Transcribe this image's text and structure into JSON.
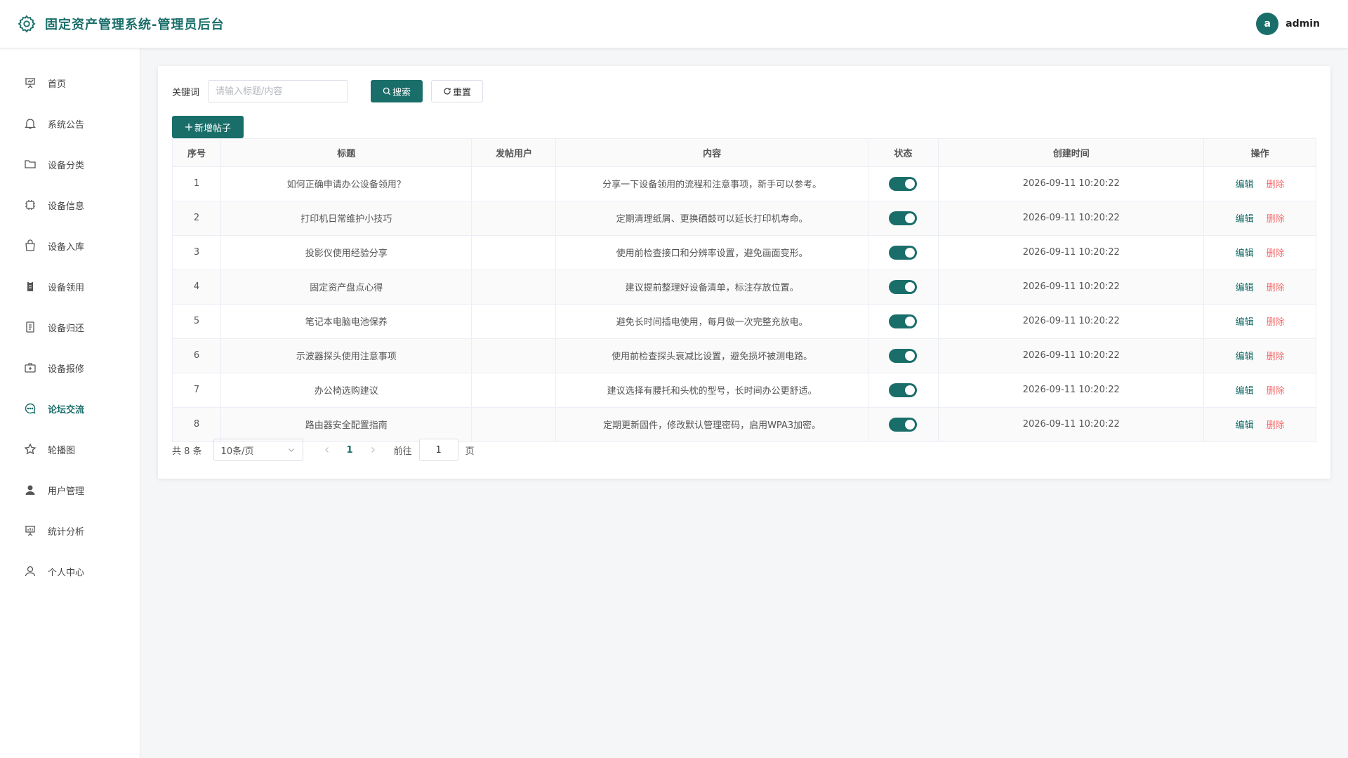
{
  "colors": {
    "brand": "#1a6e6a",
    "danger": "#f56c6c"
  },
  "header": {
    "title": "固定资产管理系统-管理员后台",
    "brand_icon": "gear-icon",
    "avatar_letter": "a",
    "username": "admin"
  },
  "sidebar": {
    "active": "论坛交流",
    "items": [
      {
        "label": "首页",
        "icon": "presentation-icon"
      },
      {
        "label": "系统公告",
        "icon": "bell-icon"
      },
      {
        "label": "设备分类",
        "icon": "folder-icon"
      },
      {
        "label": "设备信息",
        "icon": "chip-icon"
      },
      {
        "label": "设备入库",
        "icon": "shopping-bag-icon"
      },
      {
        "label": "设备领用",
        "icon": "clipboard-icon"
      },
      {
        "label": "设备归还",
        "icon": "document-icon"
      },
      {
        "label": "设备报修",
        "icon": "first-aid-kit-icon"
      },
      {
        "label": "论坛交流",
        "icon": "chat-bubble-icon"
      },
      {
        "label": "轮播图",
        "icon": "star-icon"
      },
      {
        "label": "用户管理",
        "icon": "user-filled-icon"
      },
      {
        "label": "统计分析",
        "icon": "chart-board-icon"
      },
      {
        "label": "个人中心",
        "icon": "user-outline-icon"
      }
    ]
  },
  "toolbar": {
    "keyword_label": "关键词",
    "keyword_placeholder": "请输入标题/内容",
    "keyword_value": "",
    "search_label": "搜索",
    "reset_label": "重置",
    "add_label": "新增帖子"
  },
  "table": {
    "columns": [
      "序号",
      "标题",
      "发帖用户",
      "内容",
      "状态",
      "创建时间",
      "操作"
    ],
    "edit_label": "编辑",
    "delete_label": "删除",
    "rows": [
      {
        "no": "1",
        "title": "如何正确申请办公设备领用？",
        "user": "",
        "content": "分享一下设备领用的流程和注意事项，新手可以参考。",
        "status": true,
        "created": "2026-09-11 10:20:22"
      },
      {
        "no": "2",
        "title": "打印机日常维护小技巧",
        "user": "",
        "content": "定期清理纸屑、更换硒鼓可以延长打印机寿命。",
        "status": true,
        "created": "2026-09-11 10:20:22"
      },
      {
        "no": "3",
        "title": "投影仪使用经验分享",
        "user": "",
        "content": "使用前检查接口和分辨率设置，避免画面变形。",
        "status": true,
        "created": "2026-09-11 10:20:22"
      },
      {
        "no": "4",
        "title": "固定资产盘点心得",
        "user": "",
        "content": "建议提前整理好设备清单，标注存放位置。",
        "status": true,
        "created": "2026-09-11 10:20:22"
      },
      {
        "no": "5",
        "title": "笔记本电脑电池保养",
        "user": "",
        "content": "避免长时间插电使用，每月做一次完整充放电。",
        "status": true,
        "created": "2026-09-11 10:20:22"
      },
      {
        "no": "6",
        "title": "示波器探头使用注意事项",
        "user": "",
        "content": "使用前检查探头衰减比设置，避免损坏被测电路。",
        "status": true,
        "created": "2026-09-11 10:20:22"
      },
      {
        "no": "7",
        "title": "办公椅选购建议",
        "user": "",
        "content": "建议选择有腰托和头枕的型号，长时间办公更舒适。",
        "status": true,
        "created": "2026-09-11 10:20:22"
      },
      {
        "no": "8",
        "title": "路由器安全配置指南",
        "user": "",
        "content": "定期更新固件，修改默认管理密码，启用WPA3加密。",
        "status": true,
        "created": "2026-09-11 10:20:22"
      }
    ]
  },
  "pagination": {
    "total_text": "共 8 条",
    "page_size": "10条/页",
    "current_page": "1",
    "goto_label": "前往",
    "goto_value": "1",
    "page_unit": "页"
  }
}
